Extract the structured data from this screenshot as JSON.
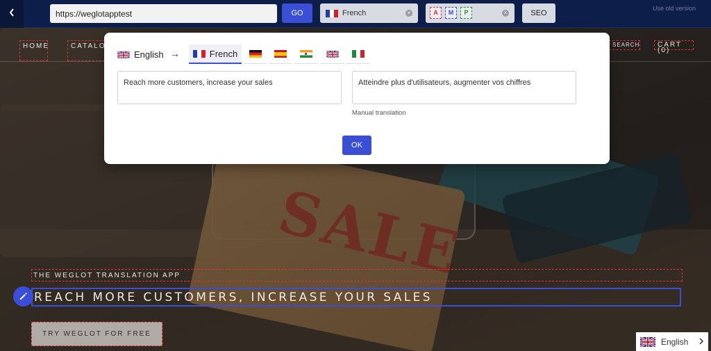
{
  "toolbar": {
    "url_value": "https://weglotapptest",
    "go_label": "GO",
    "language_selected": "French",
    "amp_tags": [
      "A",
      "M",
      "P"
    ],
    "seo_label": "SEO",
    "old_version_label": "Use old version"
  },
  "site": {
    "nav": {
      "home": "HOME",
      "catalog": "CATALOG",
      "search": "SEARCH",
      "cart": "CART (0)"
    },
    "hero": {
      "kicker": "THE WEGLOT TRANSLATION APP",
      "title": "REACH MORE CUSTOMERS, INCREASE YOUR SALES",
      "cta": "TRY WEGLOT FOR FREE",
      "sale_word": "SALE"
    },
    "language_switcher": "English"
  },
  "modal": {
    "source_language": "English",
    "arrow": "→",
    "active_target_language": "French",
    "target_languages": [
      "French",
      "German",
      "Spanish",
      "Hindi",
      "English",
      "Italian"
    ],
    "source_text": "Reach more customers, increase your sales",
    "translated_text": "Atteindre plus d'utilisateurs, augmenter vos chiffres",
    "translation_note": "Manual translation",
    "ok_label": "OK"
  },
  "colors": {
    "toolbar_bg": "#0e1e4a",
    "accent": "#3b4fd6",
    "dashed_highlight": "#dd3333"
  },
  "icons": [
    "back-chevron-icon",
    "clear-icon",
    "pencil-icon",
    "chevron-right-icon",
    "flag-uk-icon",
    "flag-fr-icon",
    "flag-de-icon",
    "flag-es-icon",
    "flag-in-icon",
    "flag-it-icon"
  ]
}
